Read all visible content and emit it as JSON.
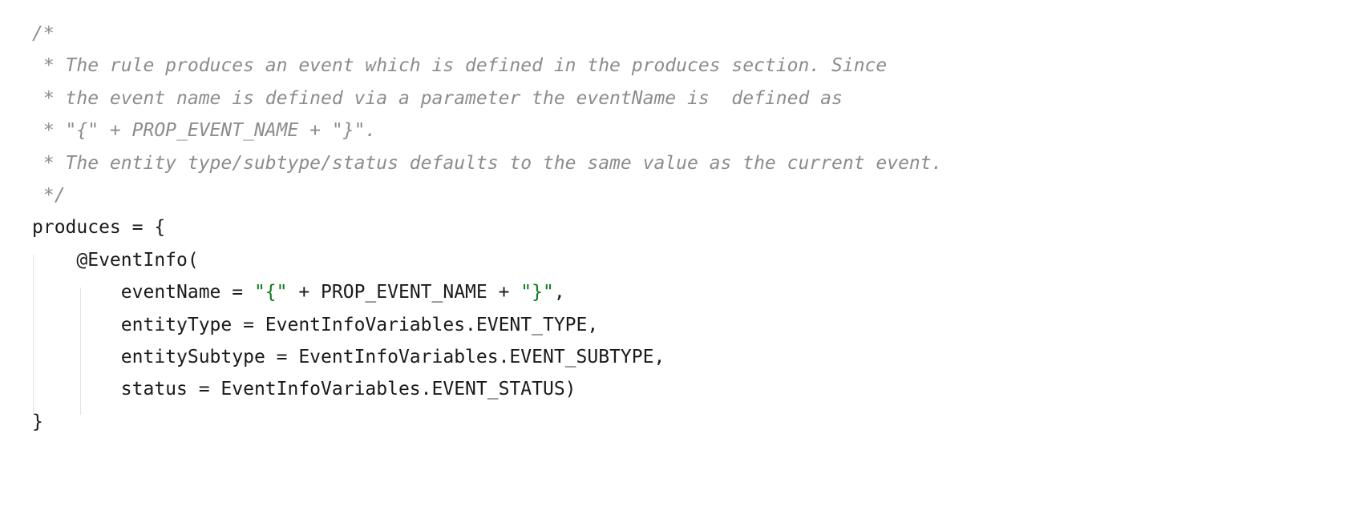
{
  "editor": {
    "language": "java",
    "background_color": "#ffffff",
    "comment_color": "#8c8c8c",
    "text_color": "#1a1a1a",
    "string_color": "#067d17",
    "indent_guide_color": "#e3e3e3",
    "code_text": "/*\n * The rule produces an event which is defined in the produces section. Since\n * the event name is defined via a parameter the eventName is  defined as\n * \"{\" + PROP_EVENT_NAME + \"}\".\n * The entity type/subtype/status defaults to the same value as the current event.\n */\nproduces = {\n    @EventInfo(\n        eventName = \"{\" + PROP_EVENT_NAME + \"}\",\n        entityType = EventInfoVariables.EVENT_TYPE,\n        entitySubtype = EventInfoVariables.EVENT_SUBTYPE,\n        status = EventInfoVariables.EVENT_STATUS)\n}",
    "lines": [
      {
        "id": "line-1",
        "tokens": [
          {
            "type": "comment",
            "text": "/*"
          }
        ]
      },
      {
        "id": "line-2",
        "tokens": [
          {
            "type": "comment",
            "text": " * The rule produces an event which is defined in the produces section. Since"
          }
        ]
      },
      {
        "id": "line-3",
        "tokens": [
          {
            "type": "comment",
            "text": " * the event name is defined via a parameter the eventName is  defined as"
          }
        ]
      },
      {
        "id": "line-4",
        "tokens": [
          {
            "type": "comment",
            "text": " * \"{\" + PROP_EVENT_NAME + \"}\"."
          }
        ]
      },
      {
        "id": "line-5",
        "tokens": [
          {
            "type": "comment",
            "text": " * The entity type/subtype/status defaults to the same value as the current event."
          }
        ]
      },
      {
        "id": "line-6",
        "tokens": [
          {
            "type": "comment",
            "text": " */"
          }
        ]
      },
      {
        "id": "line-7",
        "tokens": [
          {
            "type": "plain",
            "text": "produces = {"
          }
        ]
      },
      {
        "id": "line-8",
        "tokens": [
          {
            "type": "plain",
            "text": "    @EventInfo("
          }
        ]
      },
      {
        "id": "line-9",
        "tokens": [
          {
            "type": "plain",
            "text": "        eventName = "
          },
          {
            "type": "string",
            "text": "\"{\""
          },
          {
            "type": "plain",
            "text": " + PROP_EVENT_NAME + "
          },
          {
            "type": "string",
            "text": "\"}\""
          },
          {
            "type": "plain",
            "text": ","
          }
        ]
      },
      {
        "id": "line-10",
        "tokens": [
          {
            "type": "plain",
            "text": "        entityType = EventInfoVariables.EVENT_TYPE,"
          }
        ]
      },
      {
        "id": "line-11",
        "tokens": [
          {
            "type": "plain",
            "text": "        entitySubtype = EventInfoVariables.EVENT_SUBTYPE,"
          }
        ]
      },
      {
        "id": "line-12",
        "tokens": [
          {
            "type": "plain",
            "text": "        status = EventInfoVariables.EVENT_STATUS)"
          }
        ]
      },
      {
        "id": "line-13",
        "tokens": [
          {
            "type": "plain",
            "text": "}"
          }
        ]
      }
    ]
  }
}
